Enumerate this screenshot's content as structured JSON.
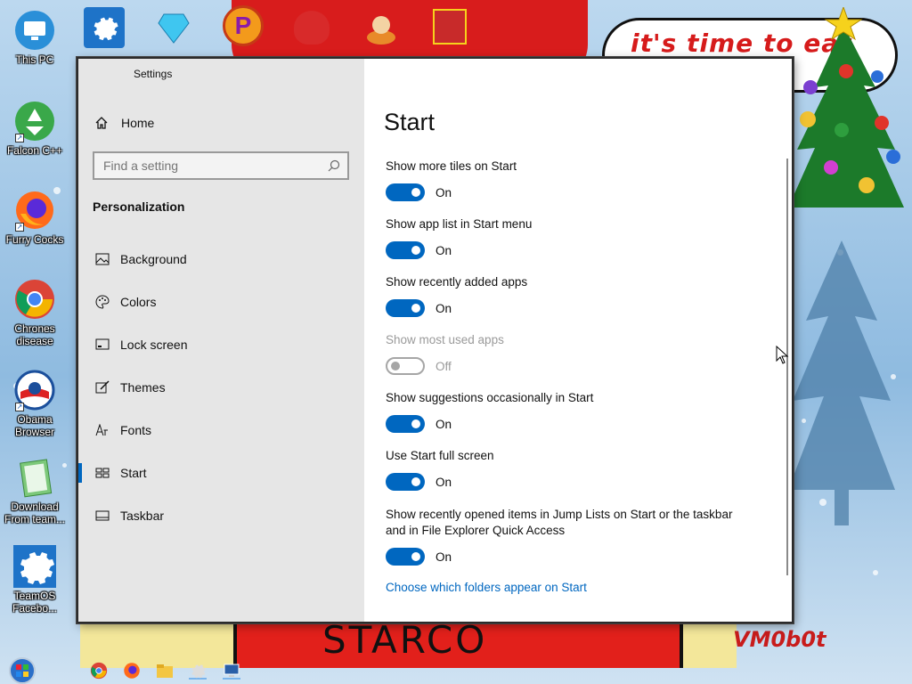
{
  "desktop": {
    "icons": [
      {
        "label": "This PC",
        "icon": "monitor-icon"
      },
      {
        "label": "Falcon C++",
        "icon": "recycle-icon"
      },
      {
        "label": "Furry Cocks",
        "icon": "firefox-icon"
      },
      {
        "label": "Chrones disease",
        "icon": "chrome-icon"
      },
      {
        "label": "Obama Browser",
        "icon": "obama-logo-icon"
      },
      {
        "label": "Download From team...",
        "icon": "notebook-icon"
      },
      {
        "label": "TeamOS Facebo...",
        "icon": "gear-icon"
      }
    ],
    "wallpaper": {
      "bubble_text": "it's time to eat",
      "banner_text": "STARCO",
      "signature": "VM0b0t"
    }
  },
  "window": {
    "title": "Settings",
    "controls": [
      "minimize",
      "maximize",
      "close"
    ],
    "sidebar": {
      "home_label": "Home",
      "search_placeholder": "Find a setting",
      "section_title": "Personalization",
      "items": [
        {
          "label": "Background",
          "icon": "picture-icon",
          "active": false
        },
        {
          "label": "Colors",
          "icon": "palette-icon",
          "active": false
        },
        {
          "label": "Lock screen",
          "icon": "lock-screen-icon",
          "active": false
        },
        {
          "label": "Themes",
          "icon": "brush-icon",
          "active": false
        },
        {
          "label": "Fonts",
          "icon": "font-icon",
          "active": false
        },
        {
          "label": "Start",
          "icon": "start-icon",
          "active": true
        },
        {
          "label": "Taskbar",
          "icon": "taskbar-icon",
          "active": false
        }
      ]
    },
    "content": {
      "title": "Start",
      "settings": [
        {
          "label": "Show more tiles on Start",
          "state": "On",
          "enabled": true
        },
        {
          "label": "Show app list in Start menu",
          "state": "On",
          "enabled": true
        },
        {
          "label": "Show recently added apps",
          "state": "On",
          "enabled": true
        },
        {
          "label": "Show most used apps",
          "state": "Off",
          "enabled": false
        },
        {
          "label": "Show suggestions occasionally in Start",
          "state": "On",
          "enabled": true
        },
        {
          "label": "Use Start full screen",
          "state": "On",
          "enabled": true
        },
        {
          "label": "Show recently opened items in Jump Lists on Start or the taskbar and in File Explorer Quick Access",
          "state": "On",
          "enabled": true
        }
      ],
      "link": "Choose which folders appear on Start"
    }
  },
  "colors": {
    "accent": "#0067c0",
    "sidebar_bg": "#e6e6e6"
  }
}
